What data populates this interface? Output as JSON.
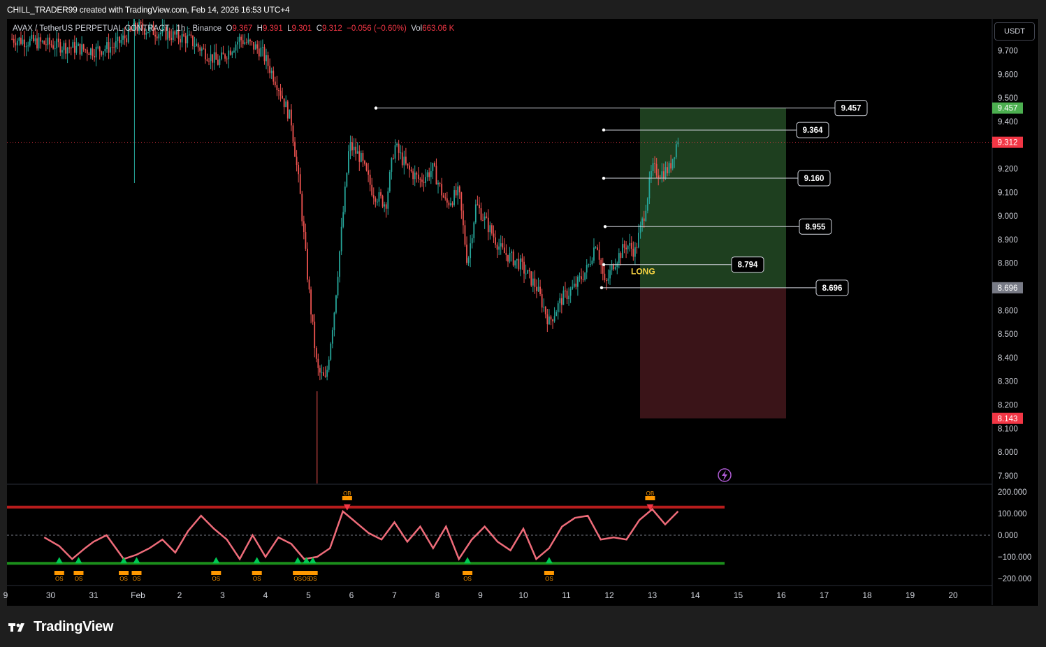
{
  "header": {
    "credit": "CHILL_TRADER99 created with TradingView.com, Feb 14, 2026 16:53 UTC+4"
  },
  "legend": {
    "symbol": "AVAX / TetherUS PERPETUAL CONTRACT · 1h · Binance",
    "o_label": "O",
    "o": "9.367",
    "h_label": "H",
    "h": "9.391",
    "l_label": "L",
    "l": "9.301",
    "c_label": "C",
    "c": "9.312",
    "change": "−0.056 (−0.60%)",
    "vol_label": "Vol",
    "vol": "663.06 K"
  },
  "currency_button": "USDT",
  "footer": {
    "brand": "TradingView"
  },
  "colors": {
    "up": "#26a69a",
    "down": "#ef5350",
    "profit_zone": "#1e3f1f",
    "loss_zone": "#3a1418",
    "osc_red_line": "#b71c1c",
    "osc_green_line": "#1b8e1b",
    "marker_orange": "#ff9800"
  },
  "chart_data": {
    "type": "candlestick",
    "symbol": "AVAX/USDT",
    "interval": "1h",
    "price_axis": {
      "ticks": [
        "9.700",
        "9.600",
        "9.500",
        "9.400",
        "9.200",
        "9.100",
        "9.000",
        "8.900",
        "8.800",
        "8.600",
        "8.500",
        "8.400",
        "8.300",
        "8.200",
        "8.100",
        "8.000",
        "7.900"
      ],
      "ylim": [
        7.88,
        9.78
      ]
    },
    "price_badges": [
      {
        "label": "9.457",
        "value": 9.457,
        "color": "#4caf50"
      },
      {
        "label": "9.312",
        "value": 9.312,
        "color": "#f23645"
      },
      {
        "label": "8.696",
        "value": 8.696,
        "color": "#787b86"
      },
      {
        "label": "8.143",
        "value": 8.143,
        "color": "#f23645"
      }
    ],
    "current_price": 9.312,
    "time_axis": [
      "9",
      "30",
      "31",
      "Feb",
      "2",
      "3",
      "4",
      "5",
      "6",
      "7",
      "8",
      "9",
      "10",
      "11",
      "12",
      "13",
      "14",
      "15",
      "16",
      "17",
      "18",
      "19",
      "20"
    ],
    "horizontal_levels": [
      {
        "label": "9.457",
        "value": 9.457
      },
      {
        "label": "9.364",
        "value": 9.364
      },
      {
        "label": "9.160",
        "value": 9.16
      },
      {
        "label": "8.955",
        "value": 8.955
      },
      {
        "label": "8.794",
        "value": 8.794
      },
      {
        "label": "8.696",
        "value": 8.696
      }
    ],
    "position": {
      "label": "LONG",
      "entry": 8.696,
      "target": 9.457,
      "stop": 8.143
    },
    "oscillator": {
      "ticks": [
        "200.000",
        "100.000",
        "0.000",
        "−100.000",
        "−200.000"
      ],
      "ylim": [
        -240,
        230
      ],
      "overbought": 130,
      "oversold": -130,
      "labels": {
        "ob": "OB",
        "os": "OS"
      },
      "series_days": [
        -0.15,
        0.2,
        0.5,
        0.8,
        1.0,
        1.3,
        1.7,
        2.0,
        2.3,
        2.6,
        2.9,
        3.2,
        3.5,
        3.8,
        4.1,
        4.4,
        4.7,
        5.0,
        5.3,
        5.6,
        5.9,
        6.2,
        6.5,
        6.8,
        7.1,
        7.4,
        7.7,
        8.0,
        8.3,
        8.6,
        8.9,
        9.2,
        9.5,
        9.8,
        10.1,
        10.4,
        10.7,
        11.0,
        11.3,
        11.6,
        11.9,
        12.2,
        12.5,
        12.8,
        13.1,
        13.4,
        13.7,
        14.0,
        14.3,
        14.6
      ],
      "series_values": [
        -10,
        -50,
        -110,
        -60,
        -30,
        0,
        -110,
        -90,
        -60,
        -20,
        -80,
        20,
        90,
        30,
        -20,
        -110,
        0,
        -100,
        -10,
        -40,
        -110,
        -100,
        -60,
        110,
        60,
        10,
        -20,
        60,
        -30,
        40,
        -60,
        40,
        -110,
        -20,
        40,
        -30,
        -70,
        30,
        -110,
        -60,
        40,
        80,
        90,
        -20,
        -10,
        -20,
        70,
        120,
        50,
        110
      ],
      "os_marker_days": [
        0.2,
        0.65,
        1.7,
        2.0,
        3.85,
        4.8,
        5.75,
        5.95,
        6.1,
        9.7,
        11.6
      ],
      "ob_marker_days": [
        6.9,
        13.95
      ]
    }
  }
}
